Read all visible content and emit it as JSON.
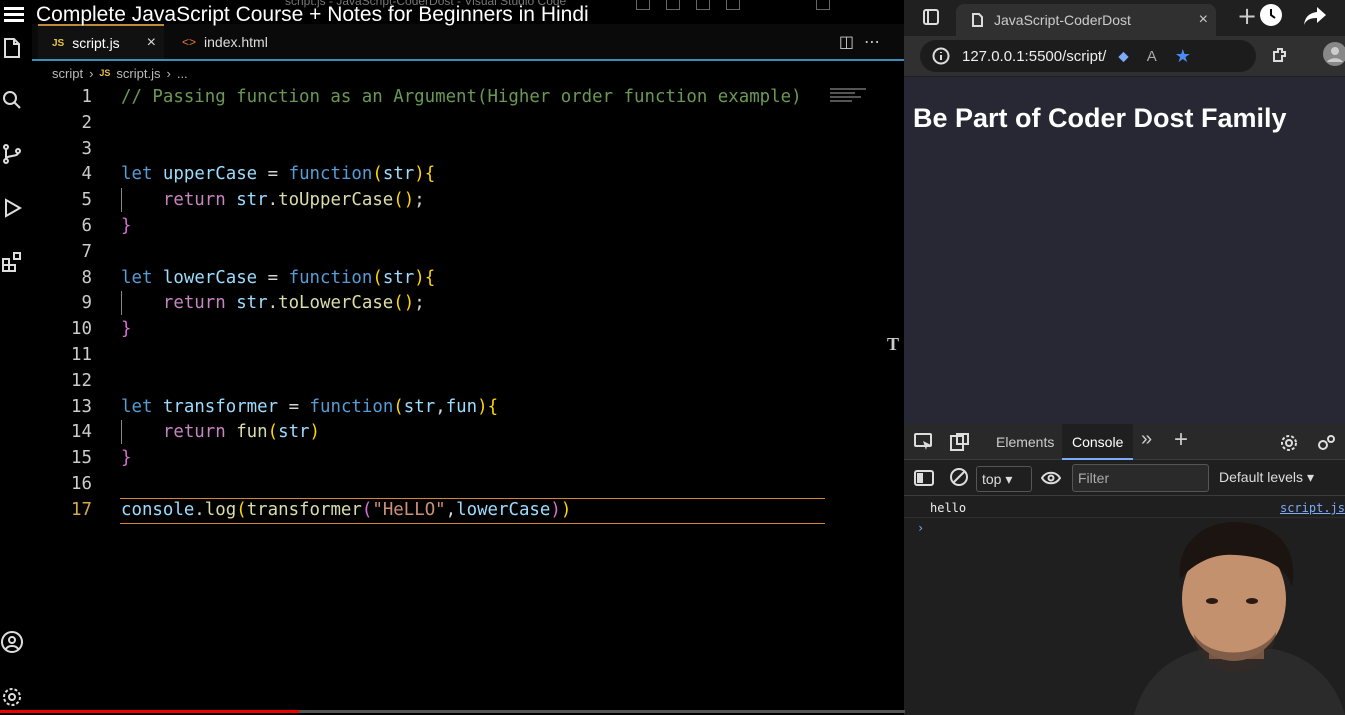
{
  "video": {
    "title": "Complete JavaScript Course + Notes for Beginners in Hindi",
    "progress_fraction": 0.33
  },
  "vscode": {
    "window_title": "script.js - JavaScript-CoderDost - Visual Studio Code",
    "tabs": [
      {
        "label": "script.js",
        "lang": "JS",
        "active": true
      },
      {
        "label": "index.html",
        "lang": "<>",
        "active": false
      }
    ],
    "breadcrumb": {
      "folder": "script",
      "lang": "JS",
      "file": "script.js",
      "more": "..."
    },
    "current_line": 17,
    "lines": [
      "// Passing function as an Argument(Higher order function example)",
      "",
      "",
      "let upperCase = function(str){",
      "    return str.toUpperCase();",
      "}",
      "",
      "let lowerCase = function(str){",
      "    return str.toLowerCase();",
      "}",
      "",
      "",
      "let transformer = function(str,fun){",
      "    return fun(str)",
      "}",
      "",
      "console.log(transformer(\"HeLLO\",lowerCase))"
    ]
  },
  "browser": {
    "tab_title": "JavaScript-CoderDost",
    "url": "127.0.0.1:5500/script/",
    "page_heading": "Be Part of Coder Dost Family",
    "devtools": {
      "tabs": [
        "Elements",
        "Console"
      ],
      "active_tab": "Console",
      "context": "top",
      "filter_placeholder": "Filter",
      "levels": "Default levels",
      "console": [
        {
          "message": "hello",
          "source": "script.js"
        }
      ]
    }
  }
}
